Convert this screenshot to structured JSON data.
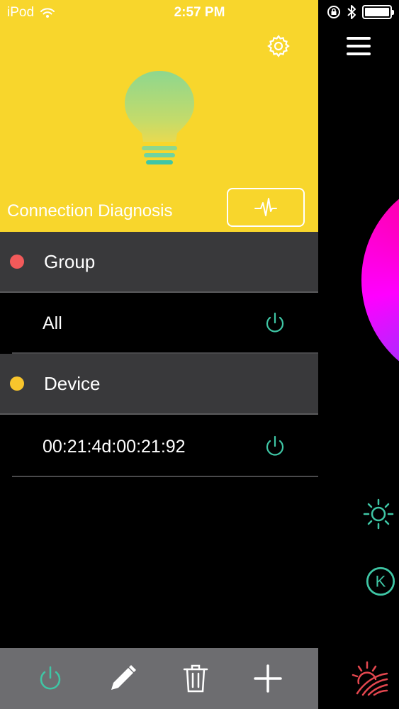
{
  "status_bar": {
    "carrier": "iPod",
    "time": "2:57 PM"
  },
  "drawer": {
    "connection_label": "Connection Diagnosis",
    "sections": {
      "group": {
        "title": "Group",
        "dot_color": "#f25a5a"
      },
      "device": {
        "title": "Device",
        "dot_color": "#f8c52c"
      }
    },
    "rows": {
      "group_items": [
        {
          "label": "All"
        }
      ],
      "device_items": [
        {
          "label": "00:21:4d:00:21:92"
        }
      ]
    },
    "toolbar": {
      "icons": [
        "power-icon",
        "pencil-icon",
        "trash-icon",
        "plus-icon"
      ]
    }
  },
  "colors": {
    "header_yellow": "#f8d62c",
    "accent_teal": "#3fc6a5",
    "section_bg": "#39393b",
    "toolbar_bg": "#6d6d70",
    "bottom_accent": "#e4474f"
  },
  "right_panel": {
    "icons": [
      "menu-icon",
      "color-wheel",
      "brightness-icon",
      "kelvin-icon",
      "sunrise-icon"
    ],
    "kelvin_letter": "K"
  }
}
